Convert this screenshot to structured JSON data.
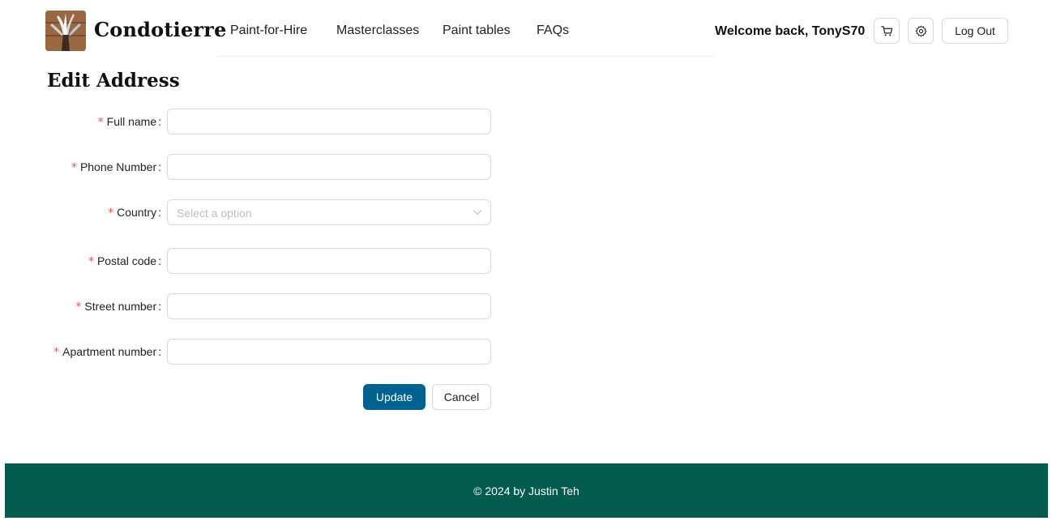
{
  "header": {
    "brand": "Condotierre",
    "nav": [
      {
        "label": "Paint-for-Hire"
      },
      {
        "label": "Masterclasses"
      },
      {
        "label": "Paint tables"
      },
      {
        "label": "FAQs"
      }
    ],
    "welcome": "Welcome back, TonyS70",
    "cart_icon": "cart-icon",
    "settings_icon": "gear-icon",
    "logout_label": "Log Out"
  },
  "page": {
    "title": "Edit Address"
  },
  "form": {
    "required_mark": "*",
    "fields": [
      {
        "label": "Full name",
        "value": ""
      },
      {
        "label": "Phone Number",
        "value": ""
      },
      {
        "label": "Country",
        "placeholder": "Select a option"
      },
      {
        "label": "Postal code",
        "value": ""
      },
      {
        "label": "Street number",
        "value": ""
      },
      {
        "label": "Apartment number",
        "value": ""
      }
    ],
    "update_label": "Update",
    "cancel_label": "Cancel"
  },
  "footer": {
    "text": "© 2024 by Justin Teh"
  },
  "colors": {
    "primary": "#00628f",
    "footer_bg": "#035c4e",
    "required": "#ff4d4f"
  }
}
